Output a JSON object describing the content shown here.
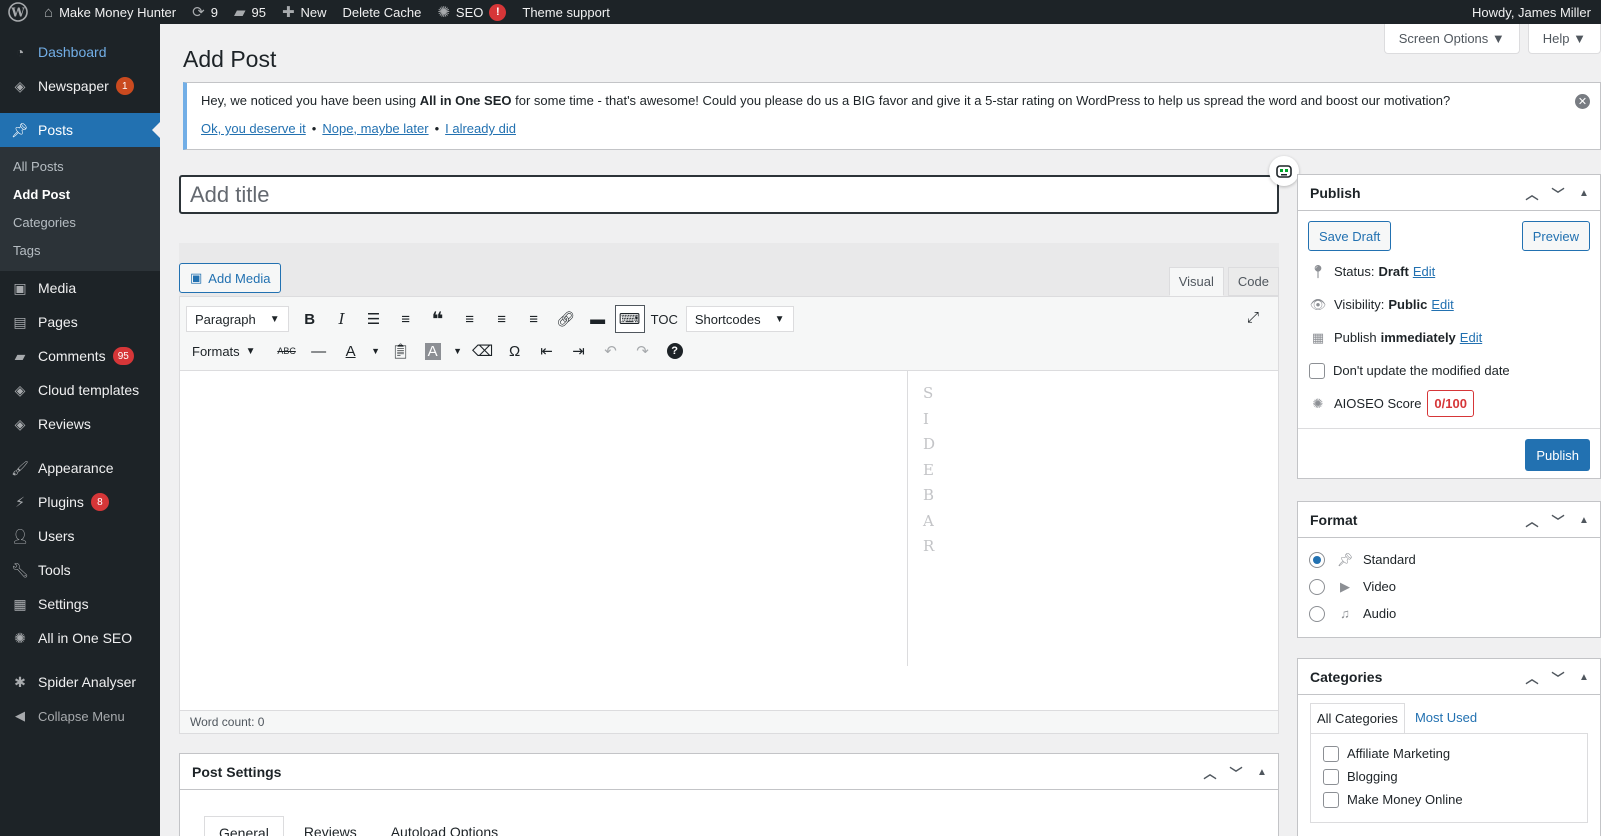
{
  "admin_bar": {
    "site_name": "Make Money Hunter",
    "updates_count": "9",
    "comments_count": "95",
    "new_label": "New",
    "delete_cache_label": "Delete Cache",
    "seo_label": "SEO",
    "seo_alert": "!",
    "theme_support_label": "Theme support",
    "howdy": "Howdy, James Miller"
  },
  "sidebar": {
    "dashboard": "Dashboard",
    "newspaper": "Newspaper",
    "newspaper_badge": "1",
    "posts": "Posts",
    "submenu": [
      "All Posts",
      "Add Post",
      "Categories",
      "Tags"
    ],
    "media": "Media",
    "pages": "Pages",
    "comments": "Comments",
    "comments_badge": "95",
    "cloud_templates": "Cloud templates",
    "reviews": "Reviews",
    "appearance": "Appearance",
    "plugins": "Plugins",
    "plugins_badge": "8",
    "users": "Users",
    "tools": "Tools",
    "settings": "Settings",
    "aioseo": "All in One SEO",
    "spider": "Spider Analyser",
    "collapse": "Collapse Menu"
  },
  "screen_meta": {
    "screen_options": "Screen Options ▼",
    "help": "Help ▼"
  },
  "page": {
    "title": "Add Post"
  },
  "notice": {
    "text_before": "Hey, we noticed you have been using ",
    "text_bold": "All in One SEO",
    "text_after": " for some time - that's awesome! Could you please do us a BIG favor and give it a 5-star rating on WordPress to help us spread the word and boost our motivation?",
    "link1": "Ok, you deserve it",
    "link2": "Nope, maybe later",
    "link3": "I already did",
    "separator": "•"
  },
  "title_field": {
    "placeholder": "Add title"
  },
  "editor": {
    "add_media": "Add Media",
    "tab_visual": "Visual",
    "tab_code": "Code",
    "paragraph_select": "Paragraph",
    "toc_label": "TOC",
    "shortcodes_select": "Shortcodes",
    "formats_label": "Formats",
    "sidebar_letters": [
      "S",
      "I",
      "D",
      "E",
      "B",
      "A",
      "R"
    ],
    "word_count": "Word count: 0"
  },
  "post_settings": {
    "title": "Post Settings",
    "tabs": [
      "General",
      "Reviews",
      "Autoload Options"
    ]
  },
  "publish_box": {
    "title": "Publish",
    "save_draft": "Save Draft",
    "preview": "Preview",
    "status_label": "Status:",
    "status_value": "Draft",
    "visibility_label": "Visibility:",
    "visibility_value": "Public",
    "publish_label": "Publish",
    "publish_value": "immediately",
    "edit_link": "Edit",
    "dont_update_label": "Don't update the modified date",
    "aioseo_score_label": "AIOSEO Score",
    "aioseo_score": "0/100",
    "publish_button": "Publish"
  },
  "format_box": {
    "title": "Format",
    "options": [
      "Standard",
      "Video",
      "Audio"
    ],
    "selected": "Standard"
  },
  "categories_box": {
    "title": "Categories",
    "tab_all": "All Categories",
    "tab_most_used": "Most Used",
    "items": [
      "Affiliate Marketing",
      "Blogging",
      "Make Money Online"
    ]
  },
  "colors": {
    "admin_dark": "#1d2327",
    "accent": "#2271b1",
    "badge_red": "#d63638",
    "background": "#f0f0f1"
  }
}
